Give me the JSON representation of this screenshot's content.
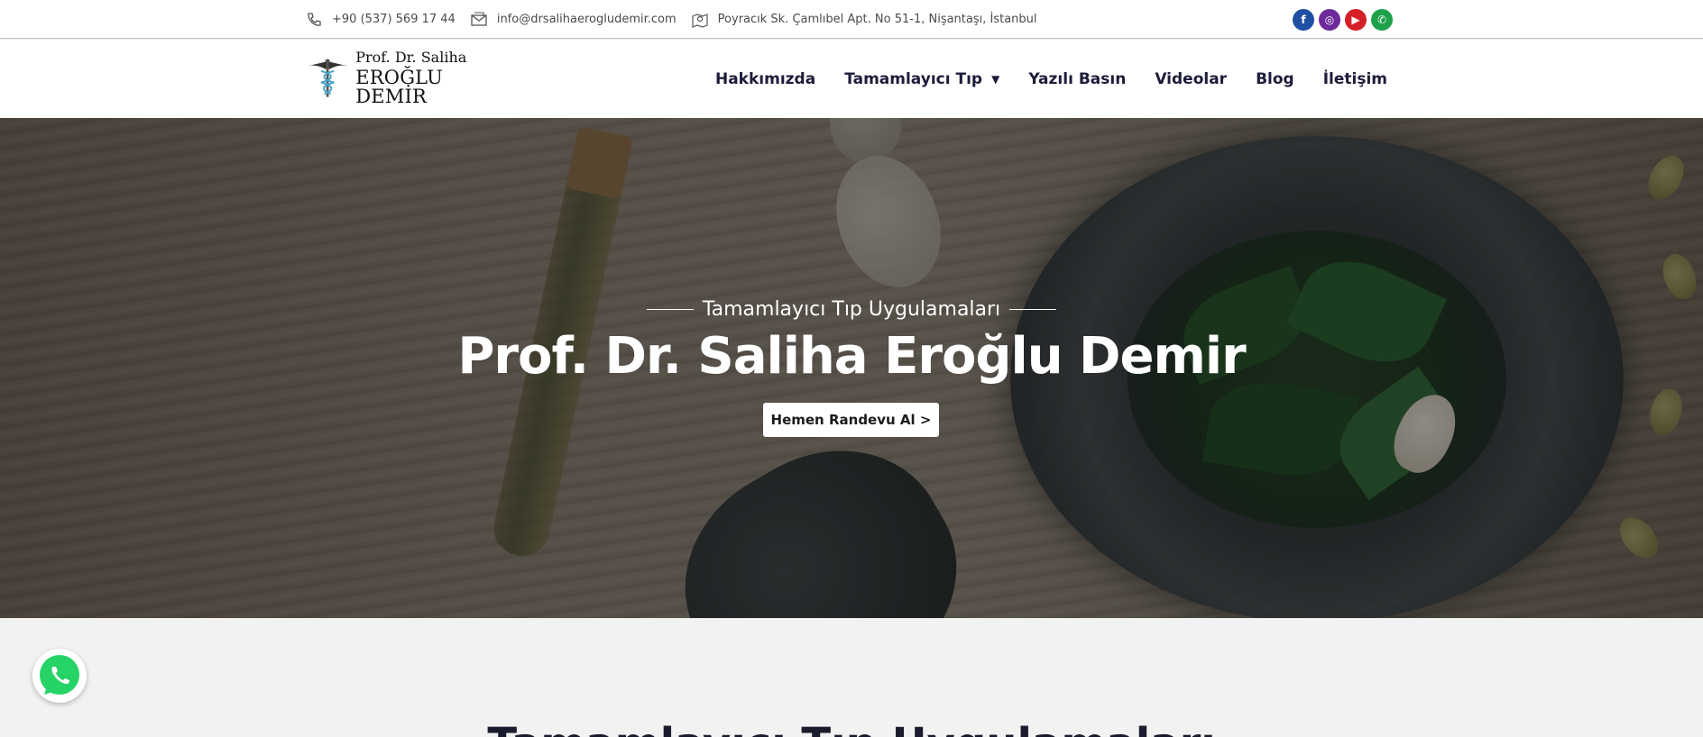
{
  "topbar": {
    "phone": "+90 (537) 569 17 44",
    "email": "info@drsalihaerogludemir.com",
    "address": "Poyracık Sk. Çamlıbel Apt. No 51-1, Nişantaşı, İstanbul",
    "socials": [
      {
        "name": "facebook",
        "glyph": "f",
        "color": "#1e4fa3"
      },
      {
        "name": "instagram",
        "glyph": "◎",
        "color": "#6d2a9a"
      },
      {
        "name": "youtube",
        "glyph": "▶",
        "color": "#d51f26"
      },
      {
        "name": "whatsapp",
        "glyph": "✆",
        "color": "#1fa04a"
      }
    ]
  },
  "header": {
    "logo_line1": "Prof. Dr. Saliha",
    "logo_line2": "EROĞLU DEMİR",
    "nav": [
      {
        "label": "Hakkımızda"
      },
      {
        "label": "Tamamlayıcı Tıp",
        "has_dropdown": true
      },
      {
        "label": "Yazılı Basın"
      },
      {
        "label": "Videolar"
      },
      {
        "label": "Blog"
      },
      {
        "label": "İletişim"
      }
    ]
  },
  "hero": {
    "eyebrow": "Tamamlayıcı Tıp Uygulamaları",
    "title": "Prof. Dr. Saliha Eroğlu Demir",
    "cta_label": "Hemen Randevu Al >"
  },
  "section": {
    "heading": "Tamamlayıcı Tıp Uygulamaları"
  },
  "colors": {
    "accent_dark": "#1c1c3a",
    "whatsapp": "#25d366"
  }
}
